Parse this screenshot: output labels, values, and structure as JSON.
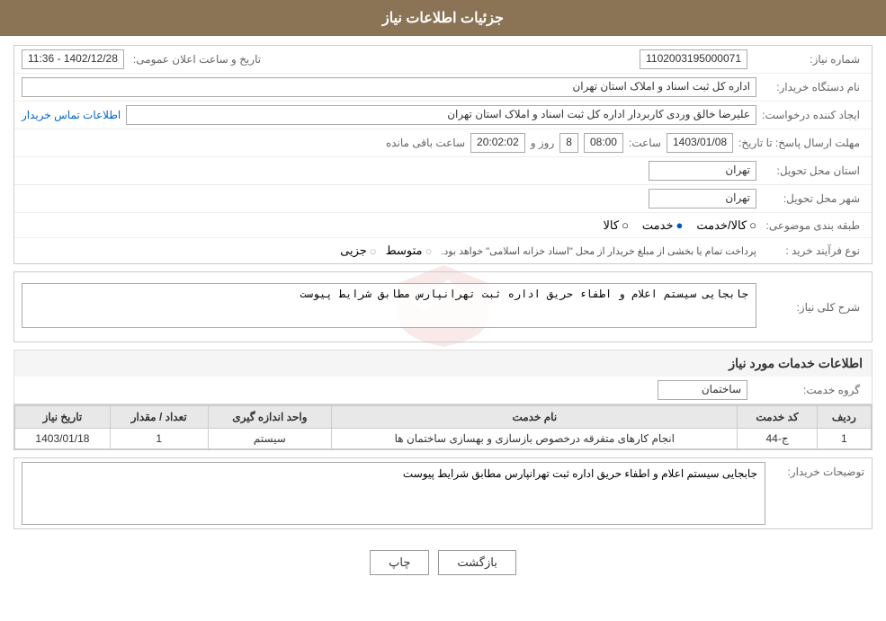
{
  "header": {
    "title": "جزئیات اطلاعات نیاز"
  },
  "fields": {
    "shomara_label": "شماره نیاز:",
    "shomara_value": "1102003195000071",
    "nam_dastgah_label": "نام دستگاه خریدار:",
    "nam_dastgah_value": "اداره کل ثبت اسناد و املاک استان تهران",
    "ijad_label": "ایجاد کننده درخواست:",
    "ijad_value": "علیرضا خالق وردی کاربردار اداره کل ثبت اسناد و املاک استان تهران",
    "ijad_link": "اطلاعات تماس خریدار",
    "mohlat_label": "مهلت ارسال پاسخ: تا تاریخ:",
    "mohlat_date": "1403/01/08",
    "mohlat_saat_label": "ساعت:",
    "mohlat_saat": "08:00",
    "mohlat_rooz_label": "روز و",
    "mohlat_rooz": "8",
    "mohlat_baqi_label": "ساعت باقی مانده",
    "mohlat_baqi": "20:02:02",
    "ostan_label": "استان محل تحویل:",
    "ostan_value": "تهران",
    "shahr_label": "شهر محل تحویل:",
    "shahr_value": "تهران",
    "tabaqe_label": "طبقه بندی موضوعی:",
    "tabaqe_options": [
      "کالا",
      "خدمت",
      "کالا/خدمت"
    ],
    "tabaqe_selected": "خدمت",
    "nooe_farayand_label": "نوع فرآیند خرید :",
    "nooe_options": [
      "جزیی",
      "متوسط"
    ],
    "nooe_note": "پرداخت تمام یا بخشی از مبلغ خریدار از محل \"اسناد خزانه اسلامی\" خواهد بود.",
    "sharh_label": "شرح کلی نیاز:",
    "sharh_value": "جابجایی سیستم اعلام و اطفاء حریق اداره ثبت تهرانپارس مطابق شرایط پیوست",
    "services_title": "اطلاعات خدمات مورد نیاز",
    "group_label": "گروه خدمت:",
    "group_value": "ساختمان",
    "table_headers": [
      "ردیف",
      "کد خدمت",
      "نام خدمت",
      "واحد اندازه گیری",
      "تعداد / مقدار",
      "تاریخ نیاز"
    ],
    "table_rows": [
      {
        "radif": "1",
        "kod": "ج-44",
        "name": "انجام کارهای متفرقه درخصوص بازسازی و بهسازی ساختمان ها",
        "vahed": "سیستم",
        "tedad": "1",
        "tarikh": "1403/01/18"
      }
    ],
    "towzih_label": "توضیحات خریدار:",
    "towzih_value": "جابجایی سیستم اعلام و اطفاء حریق اداره ثبت تهرانپارس مطابق شرایط پیوست",
    "btn_print": "چاپ",
    "btn_back": "بازگشت"
  }
}
